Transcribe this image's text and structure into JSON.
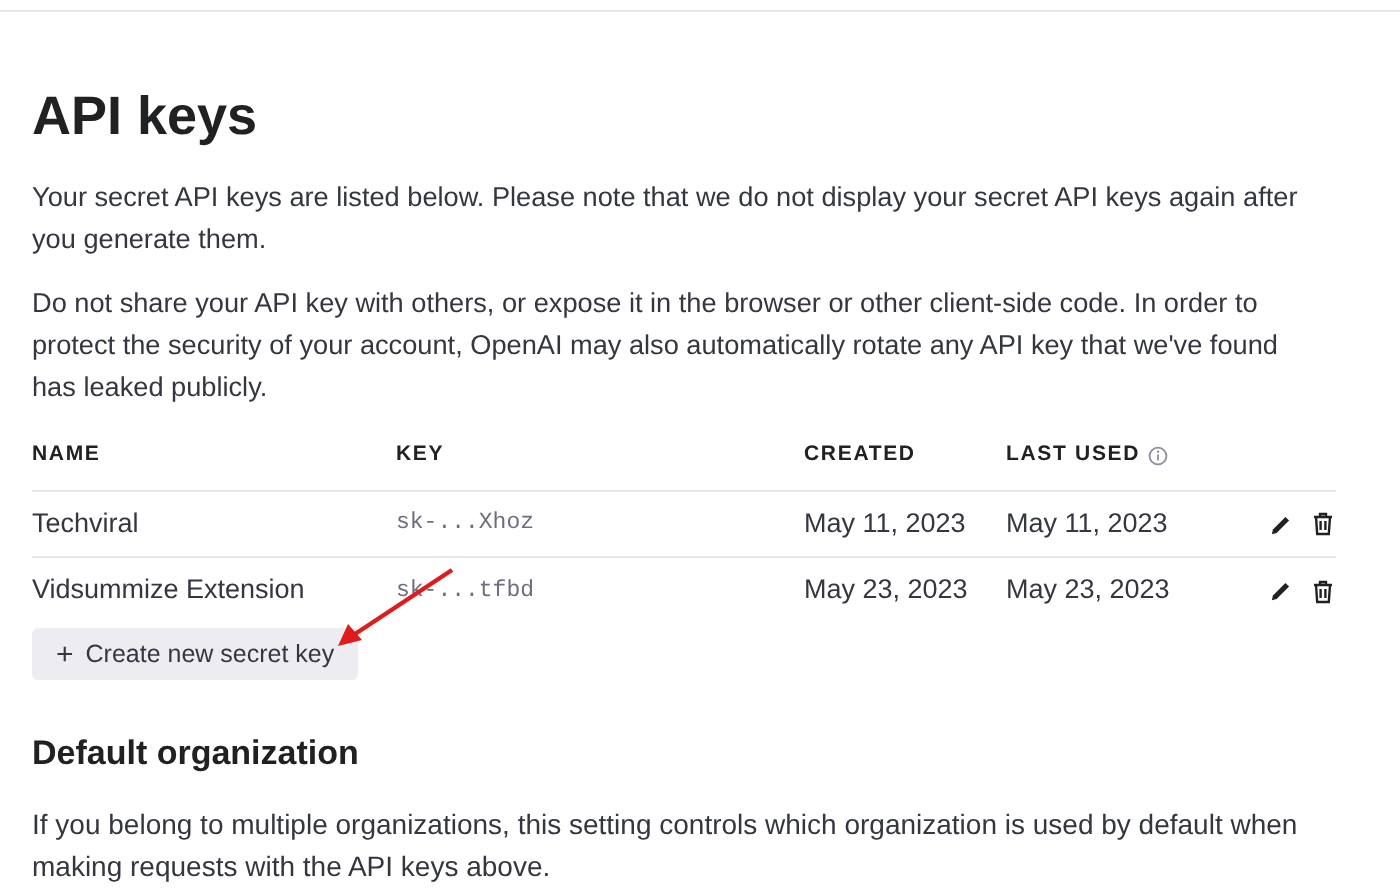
{
  "title": "API keys",
  "paragraphs": [
    "Your secret API keys are listed below. Please note that we do not display your secret API keys again after you generate them.",
    "Do not share your API key with others, or expose it in the browser or other client-side code. In order to protect the security of your account, OpenAI may also automatically rotate any API key that we've found has leaked publicly."
  ],
  "table": {
    "columns": [
      {
        "label": "NAME",
        "info": false
      },
      {
        "label": "KEY",
        "info": false
      },
      {
        "label": "CREATED",
        "info": false
      },
      {
        "label": "LAST USED",
        "info": true
      }
    ],
    "rows": [
      {
        "name": "Techviral",
        "key": "sk-...Xhoz",
        "created": "May 11, 2023",
        "last_used": "May 11, 2023"
      },
      {
        "name": "Vidsummize Extension",
        "key": "sk-...tfbd",
        "created": "May 23, 2023",
        "last_used": "May 23, 2023"
      }
    ]
  },
  "create_button": {
    "icon": "+",
    "label": "Create new secret key"
  },
  "section": {
    "title": "Default organization",
    "text": "If you belong to multiple organizations, this setting controls which organization is used by default when making requests with the API keys above."
  }
}
